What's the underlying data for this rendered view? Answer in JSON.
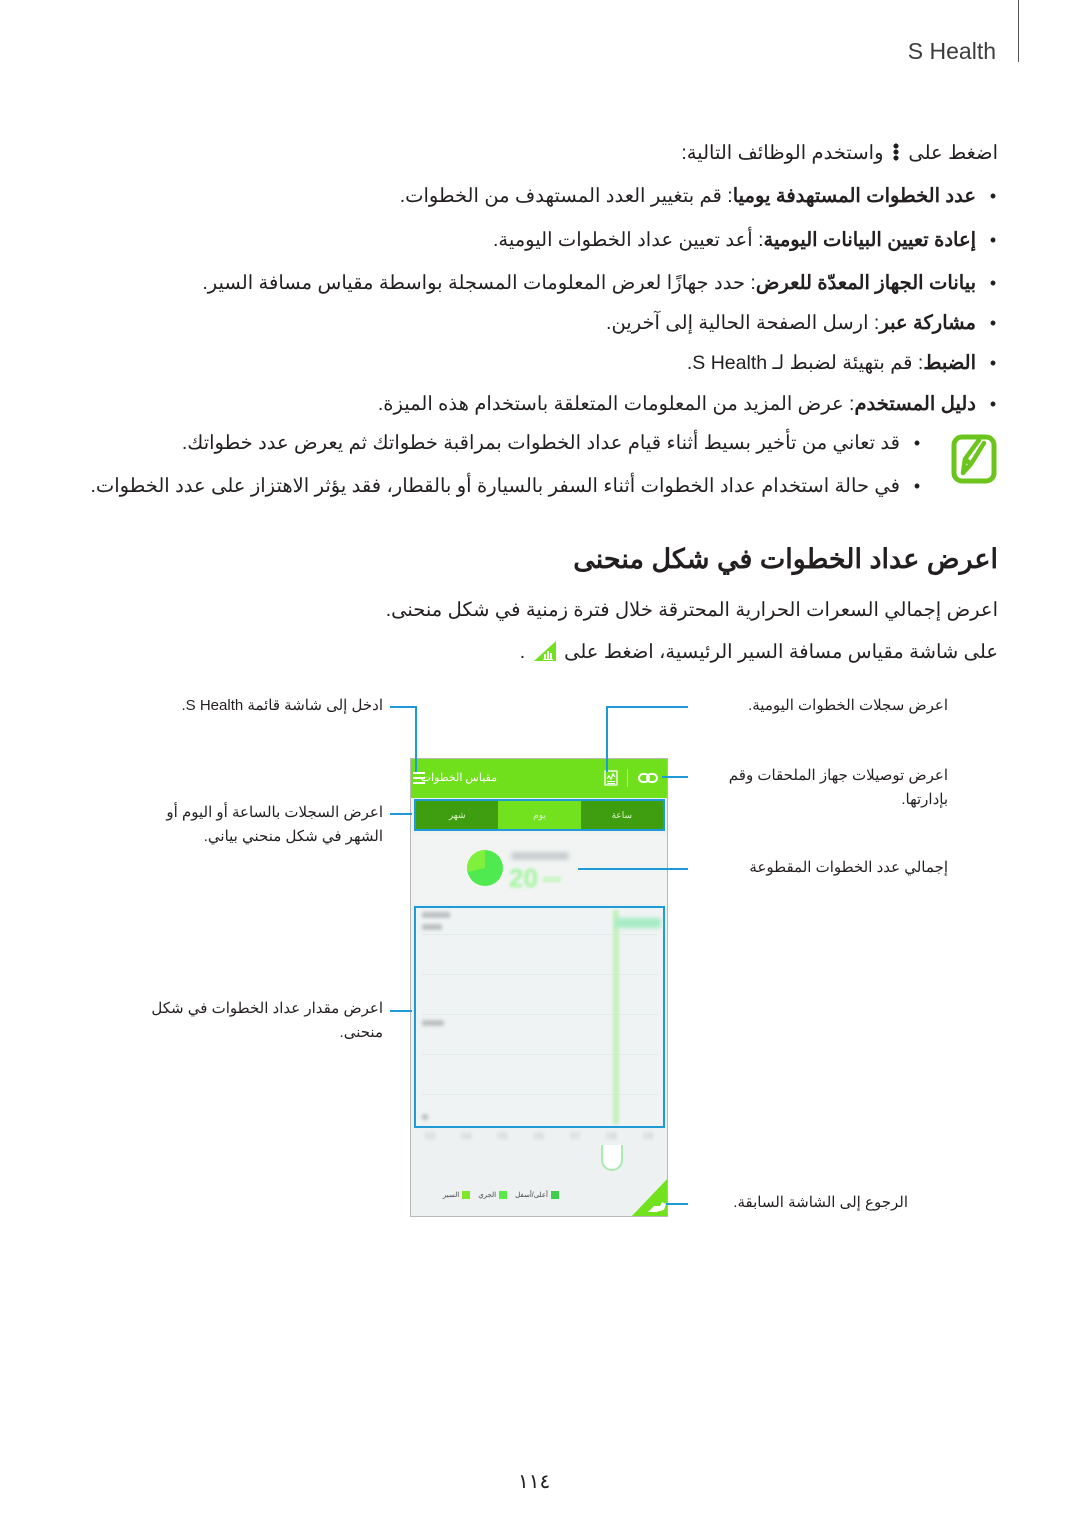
{
  "header": {
    "title": "S Health"
  },
  "intro": {
    "prefix": "اضغط على",
    "suffix": "واستخدم الوظائف التالية:",
    "icon": "more-options-icon"
  },
  "options": [
    {
      "term": "عدد الخطوات المستهدفة يوميا",
      "desc": ": قم بتغيير العدد المستهدف من الخطوات."
    },
    {
      "term": "إعادة تعيين البيانات اليومية",
      "desc": ": أعد تعيين عداد الخطوات اليومية."
    },
    {
      "term": "بيانات الجهاز المعدّة للعرض",
      "desc": ": حدد جهازًا لعرض المعلومات المسجلة بواسطة مقياس مسافة السير."
    },
    {
      "term": "مشاركة عبر",
      "desc": ": ارسل الصفحة الحالية إلى آخرين."
    },
    {
      "term": "الضبط",
      "desc": ": قم بتهيئة لضبط لـ S Health."
    },
    {
      "term": "دليل المستخدم",
      "desc": ": عرض المزيد من المعلومات المتعلقة باستخدام هذه الميزة."
    }
  ],
  "notes": {
    "icon": "note-pencil-icon",
    "items": [
      "قد تعاني من تأخير بسيط أثناء قيام عداد الخطوات بمراقبة خطواتك ثم يعرض عدد خطواتك.",
      "في حالة استخدام عداد الخطوات أثناء السفر بالسيارة أو بالقطار، فقد يؤثر الاهتزاز على عدد الخطوات."
    ]
  },
  "section": {
    "title": "اعرض عداد الخطوات في شكل منحنى",
    "para1": "اعرض إجمالي السعرات الحرارية المحترقة خلال فترة زمنية في شكل منحنى.",
    "para2_prefix": "على شاشة مقياس مسافة السير الرئيسية، اضغط على",
    "para2_suffix": ".",
    "icon": "graph-view-icon"
  },
  "phone": {
    "title": "مقياس الخطوات",
    "accent": "#72e11e",
    "tab_dark": "#3f9e10",
    "callout_color": "#1e9bd7",
    "tabs": [
      {
        "label": "ساعة",
        "active": false
      },
      {
        "label": "يوم",
        "active": true
      },
      {
        "label": "شهر",
        "active": false
      }
    ],
    "legend": [
      {
        "label": "السير",
        "color": "#7fe82a"
      },
      {
        "label": "الجري",
        "color": "#58ea45"
      },
      {
        "label": "أعلى/أسفل",
        "color": "#3fcf4a"
      }
    ],
    "x_ticks": [
      "03",
      "04",
      "05",
      "06",
      "07",
      "08",
      "09"
    ],
    "steps_value": "20"
  },
  "callouts": {
    "menu": "ادخل إلى شاشة قائمة S Health.",
    "tabs_line1": "اعرض السجلات بالساعة أو اليوم أو",
    "tabs_line2": "الشهر في شكل منحني بياني.",
    "graph_line1": "اعرض مقدار عداد الخطوات في شكل",
    "graph_line2": "منحنى.",
    "daily": "اعرض سجلات الخطوات اليومية.",
    "accessory_line1": "اعرض توصيلات جهاز الملحقات وقم",
    "accessory_line2": "بإدارتها.",
    "total": "إجمالي عدد الخطوات المقطوعة",
    "back": "الرجوع إلى الشاشة السابقة."
  },
  "page_number": "١١٤"
}
